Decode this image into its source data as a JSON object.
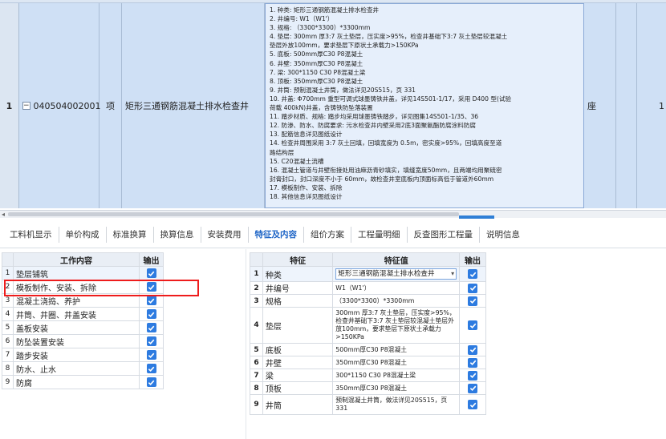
{
  "bill_item": {
    "index": "1",
    "code": "040504002001",
    "type": "项",
    "name": "矩形三通钢筋混凝土排水检查井",
    "unit": "座",
    "extra": "1",
    "features": [
      "1. 种类: 矩形三通钢筋混凝土排水检查井",
      "2. 井编号: W1（W1'）",
      "3. 规格: （3300*3300）*3300mm",
      "4. 垫层: 300mm 厚3:7 灰土垫层，压实度>95%，检查井基础下3:7 灰土垫层较混凝土",
      "垫层外放100mm，要求垫层下原状土承载力>150KPa",
      "5. 底板: 500mm厚C30 P8混凝土",
      "6. 井壁: 350mm厚C30 P8混凝土",
      "7. 梁: 300*1150 C30 P8混凝土梁",
      "8. 顶板: 350mm厚C30 P8混凝土",
      "9. 井筒: 预制混凝土井筒，做法详见20S515，页 331",
      "10. 井盖: Φ700mm 重型可调式球墨铸铁井盖，详见14S501-1/17，采用 D400 型(试验",
      "荷载 400kN)井盖，含铸铁防坠落装置",
      "11. 踏步材质、规格: 踏步均采用球墨铸铁踏步，详见图集14S501-1/35、36",
      "12. 防渗、防水、防腐要求: 污水检查井内壁采用2底3面聚氨酯防腐涂料防腐",
      "13. 配筋信息详见图纸设计",
      "14. 检查井周围采用 3:7 灰土回填，回填宽度为 0.5m，密实度>95%，回填高度至道",
      "路结构层",
      "15. C20混凝土流槽",
      "16. 混凝土管道与井壁衔接处用油麻沥青砂填实，填缝宽度50mm，且两端均用聚硫密",
      "封膏封口，封口深度不小于 60mm，故检查井室底板内顶面标高低于管道外60mm",
      "17. 模板制作、安装、拆除",
      "18. 其他信息详见图纸设计"
    ]
  },
  "tabs": [
    "工料机显示",
    "单价构成",
    "标准换算",
    "换算信息",
    "安装费用",
    "特征及内容",
    "组价方案",
    "工程量明细",
    "反查图形工程量",
    "说明信息"
  ],
  "active_tab": "特征及内容",
  "work_table": {
    "headers": [
      "工作内容",
      "输出"
    ],
    "rows": [
      {
        "idx": "1",
        "label": "垫层铺筑"
      },
      {
        "idx": "2",
        "label": "模板制作、安装、拆除"
      },
      {
        "idx": "3",
        "label": "混凝土浇捣、养护"
      },
      {
        "idx": "4",
        "label": "井筒、井圈、井盖安装"
      },
      {
        "idx": "5",
        "label": "盖板安装"
      },
      {
        "idx": "6",
        "label": "防坠装置安装"
      },
      {
        "idx": "7",
        "label": "踏步安装"
      },
      {
        "idx": "8",
        "label": "防水、止水"
      },
      {
        "idx": "9",
        "label": "防腐"
      }
    ]
  },
  "feature_table": {
    "headers": [
      "特征",
      "特征值",
      "输出"
    ],
    "rows": [
      {
        "idx": "1",
        "name": "种类",
        "value": "矩形三通钢筋混凝土排水检查井"
      },
      {
        "idx": "2",
        "name": "井编号",
        "value": "W1（W1'）"
      },
      {
        "idx": "3",
        "name": "规格",
        "value": "（3300*3300）*3300mm"
      },
      {
        "idx": "4",
        "name": "垫层",
        "value": "300mm 厚3:7 灰土垫层，压实度>95%，检查井基础下3:7 灰土垫层较混凝土垫层外放100mm，要求垫层下原状土承载力>150KPa"
      },
      {
        "idx": "5",
        "name": "底板",
        "value": "500mm厚C30 P8混凝土"
      },
      {
        "idx": "6",
        "name": "井壁",
        "value": "350mm厚C30 P8混凝土"
      },
      {
        "idx": "7",
        "name": "梁",
        "value": "300*1150 C30 P8混凝土梁"
      },
      {
        "idx": "8",
        "name": "顶板",
        "value": "350mm厚C30 P8混凝土"
      },
      {
        "idx": "9",
        "name": "井筒",
        "value": "预制混凝土井筒，做法详见20S515，页 331"
      }
    ]
  },
  "colors": {
    "accent": "#2d7be0",
    "highlight": "#ee1c1c",
    "row_selected": "#cfe0f5"
  },
  "icons": {
    "expand": "minus-box-icon",
    "checkbox": "checkbox-checked-icon",
    "dropdown": "chevron-down-icon"
  }
}
